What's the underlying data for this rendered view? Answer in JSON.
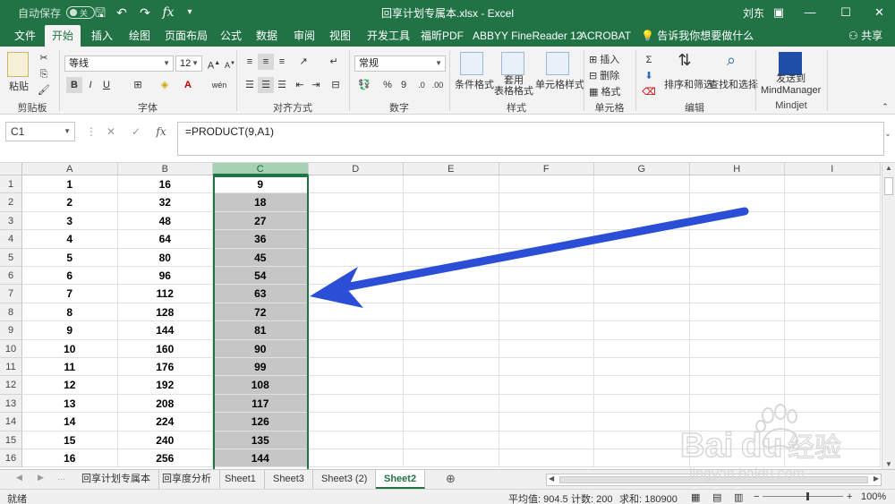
{
  "titlebar": {
    "autosave_label": "自动保存",
    "autosave_state": "关",
    "title": "回享计划专属本.xlsx  -  Excel",
    "user": "刘东",
    "minimize": "—",
    "maximize": "☐",
    "close": "✕"
  },
  "ribbon_tabs": [
    "文件",
    "开始",
    "插入",
    "绘图",
    "页面布局",
    "公式",
    "数据",
    "审阅",
    "视图",
    "开发工具",
    "福昕PDF",
    "ABBYY FineReader 12",
    "ACROBAT",
    "告诉我你想要做什么"
  ],
  "share_label": "共享",
  "ribbon": {
    "clipboard": {
      "paste": "粘贴",
      "label": "剪贴板"
    },
    "font": {
      "name": "等线",
      "size": "12",
      "label": "字体",
      "bold": "B",
      "italic": "I",
      "underline": "U",
      "wen": "wén"
    },
    "alignment": {
      "label": "对齐方式"
    },
    "number": {
      "format": "常规",
      "label": "数字",
      "percent": "%",
      "comma": "9"
    },
    "styles": {
      "conditional": "条件格式",
      "table": "套用\n表格格式",
      "cell": "单元格样式",
      "label": "样式"
    },
    "cells": {
      "insert": "插入",
      "delete": "删除",
      "format": "格式",
      "label": "单元格"
    },
    "editing": {
      "sort": "排序和筛选",
      "find": "查找和选择",
      "label": "编辑"
    },
    "mindjet": {
      "send": "发送到\nMindManager",
      "label": "Mindjet"
    }
  },
  "formula_bar": {
    "name_box": "C1",
    "cancel": "✕",
    "enter": "✓",
    "fx": "fx",
    "formula": "=PRODUCT(9,A1)"
  },
  "columns": [
    "A",
    "B",
    "C",
    "D",
    "E",
    "F",
    "G",
    "H",
    "I"
  ],
  "rows": [
    {
      "n": "1",
      "a": "1",
      "b": "16",
      "c": "9"
    },
    {
      "n": "2",
      "a": "2",
      "b": "32",
      "c": "18"
    },
    {
      "n": "3",
      "a": "3",
      "b": "48",
      "c": "27"
    },
    {
      "n": "4",
      "a": "4",
      "b": "64",
      "c": "36"
    },
    {
      "n": "5",
      "a": "5",
      "b": "80",
      "c": "45"
    },
    {
      "n": "6",
      "a": "6",
      "b": "96",
      "c": "54"
    },
    {
      "n": "7",
      "a": "7",
      "b": "112",
      "c": "63"
    },
    {
      "n": "8",
      "a": "8",
      "b": "128",
      "c": "72"
    },
    {
      "n": "9",
      "a": "9",
      "b": "144",
      "c": "81"
    },
    {
      "n": "10",
      "a": "10",
      "b": "160",
      "c": "90"
    },
    {
      "n": "11",
      "a": "11",
      "b": "176",
      "c": "99"
    },
    {
      "n": "12",
      "a": "12",
      "b": "192",
      "c": "108"
    },
    {
      "n": "13",
      "a": "13",
      "b": "208",
      "c": "117"
    },
    {
      "n": "14",
      "a": "14",
      "b": "224",
      "c": "126"
    },
    {
      "n": "15",
      "a": "15",
      "b": "240",
      "c": "135"
    },
    {
      "n": "16",
      "a": "16",
      "b": "256",
      "c": "144"
    }
  ],
  "sheets": [
    "回享计划专属本",
    "回享度分析",
    "Sheet1",
    "Sheet3",
    "Sheet3 (2)",
    "Sheet2"
  ],
  "active_sheet": "Sheet2",
  "add_sheet": "⊕",
  "status": {
    "mode": "就绪",
    "average": "平均值: 904.5",
    "count": "计数: 200",
    "sum": "求和: 180900",
    "zoom": "100%"
  },
  "watermark": {
    "text": "Bai百经验",
    "url": "jingyan.baidu.com"
  },
  "colors": {
    "excel_green": "#217346",
    "arrow_blue": "#2a4fd6",
    "selection_gray": "#c6c6c6"
  }
}
